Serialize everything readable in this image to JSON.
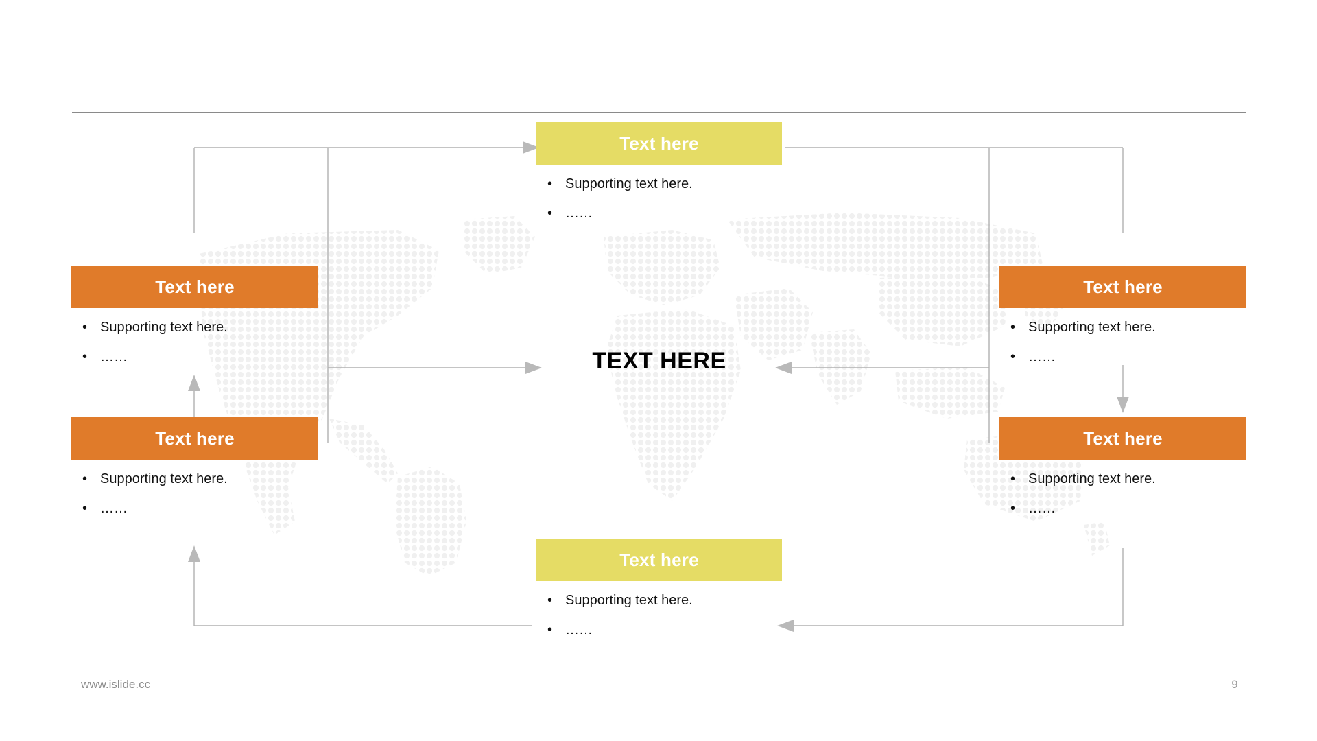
{
  "slide": {
    "page_number": "9",
    "footer_url": "www.islide.cc",
    "center_label": "TEXT HERE",
    "colors": {
      "orange": "#E07B2A",
      "yellow": "#E5DC65",
      "connector_gray": "#B0B0B0",
      "divider_gray": "#8A8A8A",
      "map_dot_gray": "#F0F0F0",
      "footer_gray": "#8C8C8C",
      "body_text": "#111111"
    }
  },
  "nodes": {
    "top": {
      "title": "Text here",
      "accent": "yellow",
      "bullets": [
        "Supporting text here.",
        "……"
      ]
    },
    "bottom": {
      "title": "Text here",
      "accent": "yellow",
      "bullets": [
        "Supporting text here.",
        "……"
      ]
    },
    "left_top": {
      "title": "Text here",
      "accent": "orange",
      "bullets": [
        "Supporting text here.",
        "……"
      ]
    },
    "left_bottom": {
      "title": "Text here",
      "accent": "orange",
      "bullets": [
        "Supporting text here.",
        "……"
      ]
    },
    "right_top": {
      "title": "Text here",
      "accent": "orange",
      "bullets": [
        "Supporting text here.",
        "……"
      ]
    },
    "right_bottom": {
      "title": "Text here",
      "accent": "orange",
      "bullets": [
        "Supporting text here.",
        "……"
      ]
    }
  },
  "bullet_marker": "•"
}
